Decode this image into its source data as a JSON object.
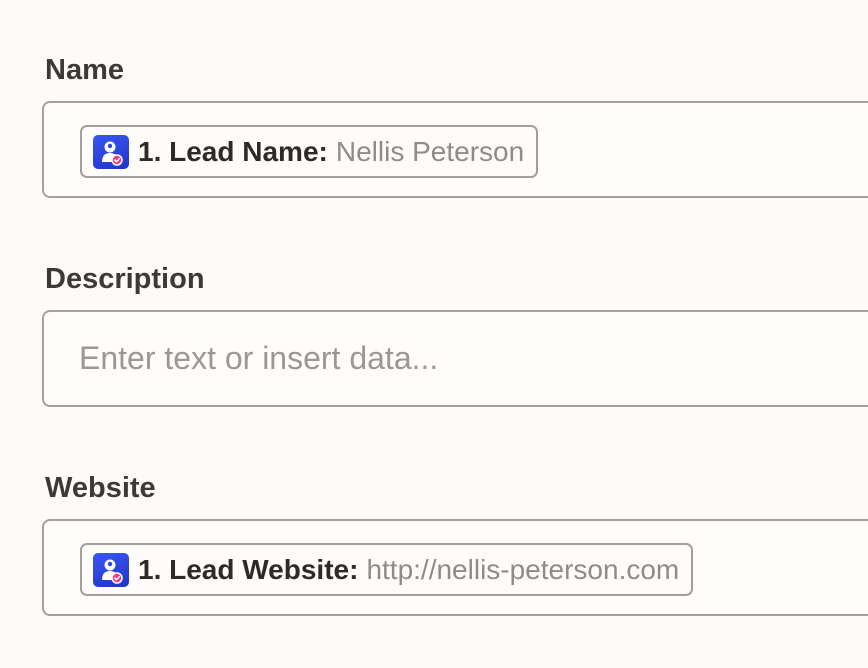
{
  "fields": {
    "name": {
      "label": "Name",
      "token_icon": "lead-app-icon",
      "token_key": "1. Lead Name:",
      "token_value": "Nellis Peterson"
    },
    "description": {
      "label": "Description",
      "placeholder": "Enter text or insert data..."
    },
    "website": {
      "label": "Website",
      "token_icon": "lead-app-icon",
      "token_key": "1. Lead Website:",
      "token_value": "http://nellis-peterson.com"
    }
  },
  "colors": {
    "background": "#fdfbfa",
    "label": "#3d3937",
    "border": "#a3a09e",
    "placeholder": "#9b9795",
    "token_value": "#8f8b89",
    "icon_blue": "#2b45e0",
    "icon_badge": "#e83e8c"
  }
}
